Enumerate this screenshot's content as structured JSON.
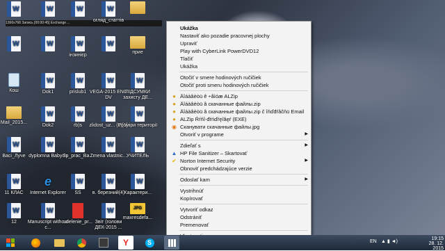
{
  "top_strip": "1366x768   Запись [00:00:45]   Exchange   ...",
  "desktop_icons": [
    {
      "label": "",
      "type": "word"
    },
    {
      "label": "",
      "type": "word"
    },
    {
      "label": "",
      "type": "word"
    },
    {
      "label": "огляд_статтів",
      "type": "word"
    },
    {
      "label": "",
      "type": "folder"
    },
    {
      "label": "",
      "type": "word"
    },
    {
      "label": "",
      "type": "word"
    },
    {
      "label": "інзинієр",
      "type": "word"
    },
    {
      "label": "",
      "type": "word"
    },
    {
      "label": "прие",
      "type": "folder"
    },
    {
      "label": "Кош",
      "type": "bin"
    },
    {
      "label": "Dok1",
      "type": "word"
    },
    {
      "label": "prislub1",
      "type": "word"
    },
    {
      "label": "VEGA-2015 ENG DV",
      "type": "word"
    },
    {
      "label": "ПІДСУМКИ захисту ДЕ...",
      "type": "word"
    },
    {
      "label": "Mail_2015...",
      "type": "folder"
    },
    {
      "label": "Dok2",
      "type": "word"
    },
    {
      "label": "rb)s",
      "type": "word"
    },
    {
      "label": "zlidost_uz... (1)[1]",
      "type": "word"
    },
    {
      "label": "Розміри території",
      "type": "word"
    },
    {
      "label": "Baci_Луче",
      "type": "word"
    },
    {
      "label": "dyplomna Babych",
      "type": "word"
    },
    {
      "label": "Sp_prac_Ba...",
      "type": "word"
    },
    {
      "label": "Zmena vlastnic...",
      "type": "word"
    },
    {
      "label": "УЧИТЕЛЬ",
      "type": "word"
    },
    {
      "label": "11 КЛАС",
      "type": "word"
    },
    {
      "label": "Internet Explorer",
      "type": "ie"
    },
    {
      "label": "SS",
      "type": "word"
    },
    {
      "label": "в. березний(4)",
      "type": "word"
    },
    {
      "label": "Характери...",
      "type": "word"
    },
    {
      "label": "12",
      "type": "word"
    },
    {
      "label": "Manuscript without c...",
      "type": "word"
    },
    {
      "label": "udelenie_pr...",
      "type": "pdf"
    },
    {
      "label": "Звіт (голови ДЕК-2015 ...",
      "type": "word"
    },
    {
      "label": "maxresdefa...",
      "type": "jpg"
    }
  ],
  "context_menu": {
    "items": [
      {
        "label": "Ukážka",
        "bold": true,
        "icon": "",
        "submenu": false
      },
      {
        "label": "Nastaviť ako pozadie pracovnej plochy",
        "icon": "",
        "submenu": false
      },
      {
        "label": "Upraviť",
        "icon": "",
        "submenu": false
      },
      {
        "label": "Play with CyberLink PowerDVD12",
        "icon": "",
        "submenu": false
      },
      {
        "label": "Tlačiť",
        "icon": "",
        "submenu": false
      },
      {
        "label": "Ukážka",
        "icon": "",
        "submenu": false
      },
      {
        "sep": true
      },
      {
        "label": "Otočiť v smere hodinových ručičiek",
        "icon": "",
        "submenu": false
      },
      {
        "label": "Otočiť proti smeru hodinových ručičiek",
        "icon": "",
        "submenu": false
      },
      {
        "sep": true
      },
      {
        "label": "Äîáàâèòü ê ÷åìóæ ALZip",
        "icon": "alzip",
        "submenu": false
      },
      {
        "label": "Äîáàâèòü â скачанные файлы.zip",
        "icon": "alzip",
        "submenu": false
      },
      {
        "label": "Äîáàâèòü â скачанные файлы.zip č îňďđŕâčňü Email",
        "icon": "alzip",
        "submenu": false
      },
      {
        "label": "ALZip Ŕŕňî-đŕńďŕęîâęŕ (EXE)",
        "icon": "alzip",
        "submenu": false
      },
      {
        "label": "Сканувати скачанные файлы.jpg",
        "icon": "scan",
        "submenu": false
      },
      {
        "label": "Otvoriť v programe",
        "icon": "",
        "submenu": true
      },
      {
        "sep": true
      },
      {
        "label": "Zdieľať s",
        "icon": "",
        "submenu": true
      },
      {
        "label": "HP File Sanitizer – Skartovať",
        "icon": "hp",
        "submenu": false
      },
      {
        "label": "Norton Internet Security",
        "icon": "norton",
        "submenu": true
      },
      {
        "label": "Obnoviť predchádzajúce verzie",
        "icon": "",
        "submenu": false
      },
      {
        "sep": true
      },
      {
        "label": "Odoslať kam",
        "icon": "",
        "submenu": true
      },
      {
        "sep": true
      },
      {
        "label": "Vystrihnúť",
        "icon": "",
        "submenu": false
      },
      {
        "label": "Kopírovať",
        "icon": "",
        "submenu": false
      },
      {
        "sep": true
      },
      {
        "label": "Vytvoriť odkaz",
        "icon": "",
        "submenu": false
      },
      {
        "label": "Odstrániť",
        "icon": "",
        "submenu": false
      },
      {
        "label": "Premenovať",
        "icon": "",
        "submenu": false
      },
      {
        "sep": true
      },
      {
        "label": "Vlastnosti",
        "icon": "",
        "submenu": false
      }
    ]
  },
  "taskbar": {
    "apps": [
      "folder",
      "media-player",
      "chrome",
      "video",
      "yandex",
      "skype",
      "windows-store"
    ],
    "language": "EN",
    "time": "19:15",
    "date": "28. 12. 2015"
  },
  "colors": {
    "word_blue": "#2b579a",
    "menu_bg": "#f3f3f3",
    "taskbar": "#2a3646"
  }
}
